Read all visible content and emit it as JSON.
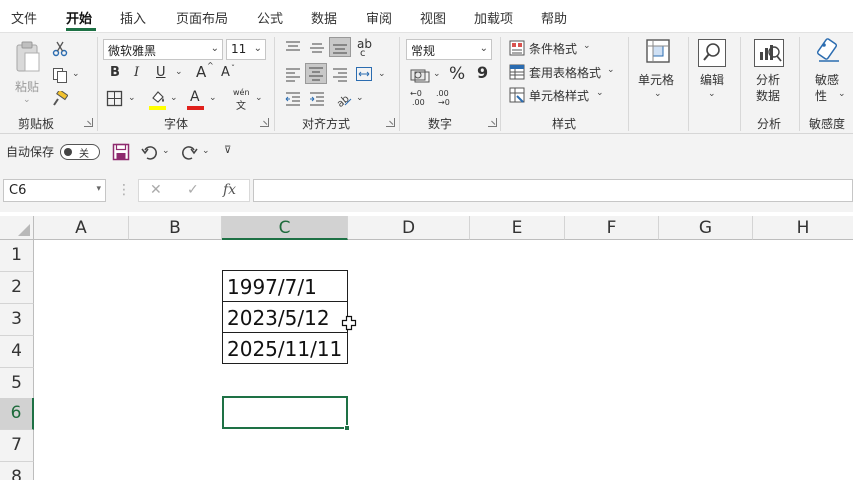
{
  "menu_tabs": [
    "文件",
    "开始",
    "插入",
    "页面布局",
    "公式",
    "数据",
    "审阅",
    "视图",
    "加载项",
    "帮助"
  ],
  "ribbon": {
    "clipboard": {
      "paste": "粘贴",
      "label": "剪贴板"
    },
    "font": {
      "name": "微软雅黑",
      "size": "11",
      "bold": "B",
      "italic": "I",
      "underline": "U",
      "grow": "A",
      "shrink": "A",
      "phonetic_top": "wén",
      "phonetic_bottom": "文",
      "label": "字体",
      "highlight_color": "#ffff00",
      "font_color": "#e0201b"
    },
    "alignment": {
      "label": "对齐方式",
      "wrap": "ab",
      "wrap2": "c"
    },
    "number": {
      "format": "常规",
      "percent": "%",
      "comma": "9",
      "inc_dec": ".00",
      "dec_dec": ".00",
      "label": "数字"
    },
    "styles": {
      "conditional": "条件格式",
      "table": "套用表格格式",
      "cell": "单元格样式",
      "label": "样式"
    },
    "cells": {
      "label_btn": "单元格"
    },
    "editing": {
      "label_btn": "编辑"
    },
    "analysis": {
      "btn_line1": "分析",
      "btn_line2": "数据",
      "label": "分析"
    },
    "sensitivity": {
      "btn_line1": "敏感",
      "btn_line2": "性",
      "label": "敏感度"
    }
  },
  "qat": {
    "autosave": "自动保存",
    "toggle_state": "关"
  },
  "formula_bar": {
    "name_box": "C6",
    "cancel": "✕",
    "enter": "✓",
    "fx": "fx",
    "formula": ""
  },
  "grid": {
    "columns": [
      "A",
      "B",
      "C",
      "D",
      "E",
      "F",
      "G",
      "H"
    ],
    "rows": [
      "1",
      "2",
      "3",
      "4",
      "5",
      "6",
      "7",
      "8"
    ],
    "cells": {
      "C2": "1997/7/1",
      "C3": "2023/5/12",
      "C4": "2025/11/11",
      "C6": ""
    },
    "selected_cell": "C6",
    "accent": "#1e7145"
  }
}
